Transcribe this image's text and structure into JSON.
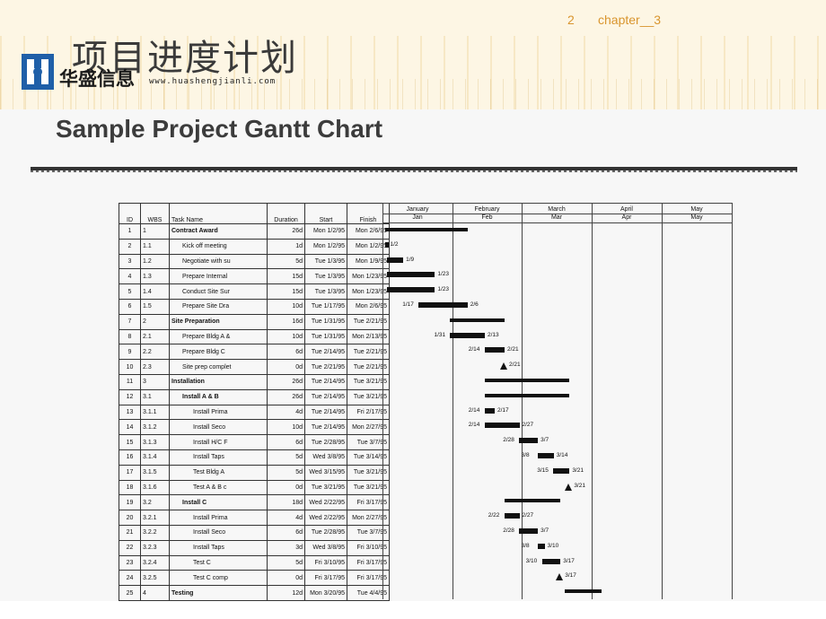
{
  "header": {
    "page_number": "2",
    "chapter": "chapter__3",
    "cn_title": "项目进度计划",
    "logo_text": "华盛信息",
    "url": "www.huashengjianli.com"
  },
  "document": {
    "title": "Sample Project Gantt Chart"
  },
  "gantt": {
    "columns": [
      "ID",
      "WBS",
      "Task Name",
      "Duration",
      "Start",
      "Finish"
    ],
    "months_top": [
      "January",
      "February",
      "March",
      "April",
      "May"
    ],
    "months_bottom": [
      "Jan",
      "Feb",
      "Mar",
      "Apr",
      "May"
    ],
    "rows": [
      {
        "id": "1",
        "wbs": "1",
        "name": "Contract Award",
        "dur": "26d",
        "start": "Mon 1/2/95",
        "finish": "Mon 2/6/95",
        "level": 0,
        "summary": true
      },
      {
        "id": "2",
        "wbs": "1.1",
        "name": "Kick off meeting",
        "dur": "1d",
        "start": "Mon 1/2/95",
        "finish": "Mon 1/2/95",
        "level": 1,
        "summary": false
      },
      {
        "id": "3",
        "wbs": "1.2",
        "name": "Negotiate with su",
        "dur": "5d",
        "start": "Tue 1/3/95",
        "finish": "Mon 1/9/95",
        "level": 1,
        "summary": false
      },
      {
        "id": "4",
        "wbs": "1.3",
        "name": "Prepare Internal",
        "dur": "15d",
        "start": "Tue 1/3/95",
        "finish": "Mon 1/23/95",
        "level": 1,
        "summary": false
      },
      {
        "id": "5",
        "wbs": "1.4",
        "name": "Conduct Site Sur",
        "dur": "15d",
        "start": "Tue 1/3/95",
        "finish": "Mon 1/23/95",
        "level": 1,
        "summary": false
      },
      {
        "id": "6",
        "wbs": "1.5",
        "name": "Prepare Site Dra",
        "dur": "10d",
        "start": "Tue 1/17/95",
        "finish": "Mon 2/6/95",
        "level": 1,
        "summary": false
      },
      {
        "id": "7",
        "wbs": "2",
        "name": "Site Preparation",
        "dur": "16d",
        "start": "Tue 1/31/95",
        "finish": "Tue 2/21/95",
        "level": 0,
        "summary": true
      },
      {
        "id": "8",
        "wbs": "2.1",
        "name": "Prepare Bldg A &",
        "dur": "10d",
        "start": "Tue 1/31/95",
        "finish": "Mon 2/13/95",
        "level": 1,
        "summary": false
      },
      {
        "id": "9",
        "wbs": "2.2",
        "name": "Prepare Bldg C",
        "dur": "6d",
        "start": "Tue 2/14/95",
        "finish": "Tue 2/21/95",
        "level": 1,
        "summary": false
      },
      {
        "id": "10",
        "wbs": "2.3",
        "name": "Site prep complet",
        "dur": "0d",
        "start": "Tue 2/21/95",
        "finish": "Tue 2/21/95",
        "level": 1,
        "summary": false
      },
      {
        "id": "11",
        "wbs": "3",
        "name": "Installation",
        "dur": "26d",
        "start": "Tue 2/14/95",
        "finish": "Tue 3/21/95",
        "level": 0,
        "summary": true
      },
      {
        "id": "12",
        "wbs": "3.1",
        "name": "Install A & B",
        "dur": "26d",
        "start": "Tue 2/14/95",
        "finish": "Tue 3/21/95",
        "level": 1,
        "summary": true
      },
      {
        "id": "13",
        "wbs": "3.1.1",
        "name": "Install Prima",
        "dur": "4d",
        "start": "Tue 2/14/95",
        "finish": "Fri 2/17/95",
        "level": 2,
        "summary": false
      },
      {
        "id": "14",
        "wbs": "3.1.2",
        "name": "Install Seco",
        "dur": "10d",
        "start": "Tue 2/14/95",
        "finish": "Mon 2/27/95",
        "level": 2,
        "summary": false
      },
      {
        "id": "15",
        "wbs": "3.1.3",
        "name": "Install H/C F",
        "dur": "6d",
        "start": "Tue 2/28/95",
        "finish": "Tue 3/7/95",
        "level": 2,
        "summary": false
      },
      {
        "id": "16",
        "wbs": "3.1.4",
        "name": "Install Taps",
        "dur": "5d",
        "start": "Wed 3/8/95",
        "finish": "Tue 3/14/95",
        "level": 2,
        "summary": false
      },
      {
        "id": "17",
        "wbs": "3.1.5",
        "name": "Test Bldg A",
        "dur": "5d",
        "start": "Wed 3/15/95",
        "finish": "Tue 3/21/95",
        "level": 2,
        "summary": false
      },
      {
        "id": "18",
        "wbs": "3.1.6",
        "name": "Test A & B c",
        "dur": "0d",
        "start": "Tue 3/21/95",
        "finish": "Tue 3/21/95",
        "level": 2,
        "summary": false
      },
      {
        "id": "19",
        "wbs": "3.2",
        "name": "Install C",
        "dur": "18d",
        "start": "Wed 2/22/95",
        "finish": "Fri 3/17/95",
        "level": 1,
        "summary": true
      },
      {
        "id": "20",
        "wbs": "3.2.1",
        "name": "Install Prima",
        "dur": "4d",
        "start": "Wed 2/22/95",
        "finish": "Mon 2/27/95",
        "level": 2,
        "summary": false
      },
      {
        "id": "21",
        "wbs": "3.2.2",
        "name": "Install Seco",
        "dur": "6d",
        "start": "Tue 2/28/95",
        "finish": "Tue 3/7/95",
        "level": 2,
        "summary": false
      },
      {
        "id": "22",
        "wbs": "3.2.3",
        "name": "Install Taps",
        "dur": "3d",
        "start": "Wed 3/8/95",
        "finish": "Fri 3/10/95",
        "level": 2,
        "summary": false
      },
      {
        "id": "23",
        "wbs": "3.2.4",
        "name": "Test C",
        "dur": "5d",
        "start": "Fri 3/10/95",
        "finish": "Fri 3/17/95",
        "level": 2,
        "summary": false
      },
      {
        "id": "24",
        "wbs": "3.2.5",
        "name": "Test C comp",
        "dur": "0d",
        "start": "Fri 3/17/95",
        "finish": "Fri 3/17/95",
        "level": 2,
        "summary": false
      },
      {
        "id": "25",
        "wbs": "4",
        "name": "Testing",
        "dur": "12d",
        "start": "Mon 3/20/95",
        "finish": "Tue 4/4/95",
        "level": 0,
        "summary": true
      }
    ],
    "bar_labels": [
      {
        "row": 2,
        "text": "1/2"
      },
      {
        "row": 3,
        "text": "1/9"
      },
      {
        "row": 4,
        "text": "1/23"
      },
      {
        "row": 5,
        "text": "1/23"
      },
      {
        "row": 6,
        "text": "1/17"
      },
      {
        "row": 6,
        "text": "2/6"
      },
      {
        "row": 8,
        "text": "1/31"
      },
      {
        "row": 8,
        "text": "2/13"
      },
      {
        "row": 9,
        "text": "2/14"
      },
      {
        "row": 9,
        "text": "2/21"
      },
      {
        "row": 10,
        "text": "2/21"
      },
      {
        "row": 13,
        "text": "2/14"
      },
      {
        "row": 13,
        "text": "2/17"
      },
      {
        "row": 14,
        "text": "2/14"
      },
      {
        "row": 14,
        "text": "2/27"
      },
      {
        "row": 15,
        "text": "2/28"
      },
      {
        "row": 15,
        "text": "3/7"
      },
      {
        "row": 16,
        "text": "3/8"
      },
      {
        "row": 16,
        "text": "3/14"
      },
      {
        "row": 17,
        "text": "3/15"
      },
      {
        "row": 17,
        "text": "3/21"
      },
      {
        "row": 18,
        "text": "3/21"
      },
      {
        "row": 20,
        "text": "2/22"
      },
      {
        "row": 20,
        "text": "2/27"
      },
      {
        "row": 21,
        "text": "2/28"
      },
      {
        "row": 21,
        "text": "3/7"
      },
      {
        "row": 22,
        "text": "3/8"
      },
      {
        "row": 22,
        "text": "3/10"
      },
      {
        "row": 23,
        "text": "3/10"
      },
      {
        "row": 23,
        "text": "3/17"
      },
      {
        "row": 24,
        "text": "3/17"
      }
    ]
  }
}
